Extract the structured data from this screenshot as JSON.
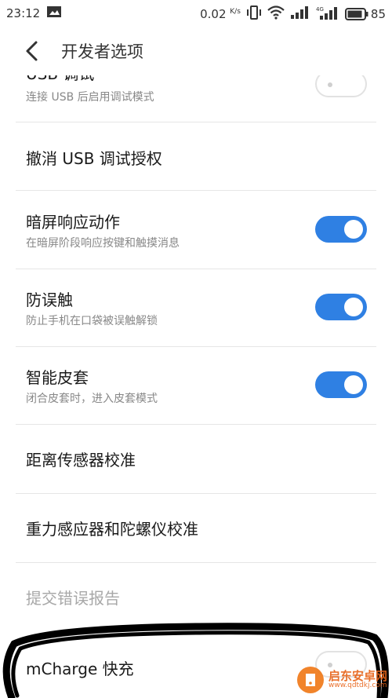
{
  "status_bar": {
    "time": "23:12",
    "net_speed": "0.02",
    "net_unit": "K/s",
    "battery": "85",
    "icons": [
      "gallery-icon",
      "vibrate-icon",
      "wifi-icon",
      "signal-icon",
      "signal-4g-icon",
      "battery-icon"
    ]
  },
  "header": {
    "title": "开发者选项",
    "back_icon": "chevron-left-icon"
  },
  "settings": [
    {
      "title": "USB 调试",
      "subtitle": "连接 USB 后启用调试模式",
      "toggle": "off"
    },
    {
      "title": "撤消 USB 调试授权"
    },
    {
      "title": "暗屏响应动作",
      "subtitle": "在暗屏阶段响应按键和触摸消息",
      "toggle": "on"
    },
    {
      "title": "防误触",
      "subtitle": "防止手机在口袋被误触解锁",
      "toggle": "on"
    },
    {
      "title": "智能皮套",
      "subtitle": "闭合皮套时，进入皮套模式",
      "toggle": "on"
    },
    {
      "title": "距离传感器校准"
    },
    {
      "title": "重力感应器和陀螺仪校准"
    },
    {
      "title": "提交错误报告",
      "disabled": true
    },
    {
      "title": "mCharge 快充",
      "toggle": "off"
    }
  ],
  "watermark": {
    "brand": "启东安卓网",
    "url": "www.qdtdkj.com"
  },
  "colors": {
    "accent": "#2f80e3",
    "annotation": "#000000"
  }
}
